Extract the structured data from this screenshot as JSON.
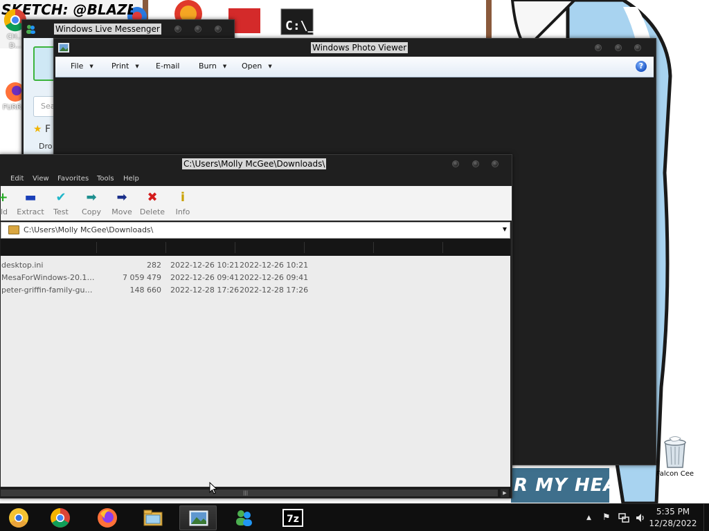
{
  "desktop": {
    "handle_text": "SKETCH: @BLAZENARF",
    "icons": [
      {
        "label": "CH..."
      },
      {
        "label": "D..."
      },
      {
        "label": "FURR..."
      }
    ],
    "recycle_bin_label": "Falcon Cee",
    "banner_text": "R MY HEAD..."
  },
  "messenger": {
    "title": "Windows Live Messenger",
    "search_placeholder": "Sea",
    "favorites_label": "F",
    "drop_label": "Dro"
  },
  "photo_viewer": {
    "title": "Windows Photo Viewer",
    "menu": [
      {
        "label": "File",
        "has_arrow": true
      },
      {
        "label": "Print",
        "has_arrow": true
      },
      {
        "label": "E-mail",
        "has_arrow": false
      },
      {
        "label": "Burn",
        "has_arrow": true
      },
      {
        "label": "Open",
        "has_arrow": true
      }
    ],
    "help_glyph": "?"
  },
  "zip": {
    "title": "C:\\Users\\Molly McGee\\Downloads\\",
    "menu": [
      "Edit",
      "View",
      "Favorites",
      "Tools",
      "Help"
    ],
    "toolbar": [
      {
        "label": "ld",
        "icon": "add-icon",
        "glyph": "+",
        "color": "#22aa22"
      },
      {
        "label": "Extract",
        "icon": "extract-icon",
        "glyph": "▬",
        "color": "#1a3fb8"
      },
      {
        "label": "Test",
        "icon": "test-icon",
        "glyph": "✔",
        "color": "#1fb6c9"
      },
      {
        "label": "Copy",
        "icon": "copy-icon",
        "glyph": "➡",
        "color": "#1d8f8f"
      },
      {
        "label": "Move",
        "icon": "move-icon",
        "glyph": "➡",
        "color": "#1a2f8a"
      },
      {
        "label": "Delete",
        "icon": "delete-icon",
        "glyph": "✖",
        "color": "#d41c1c"
      },
      {
        "label": "Info",
        "icon": "info-icon",
        "glyph": "i",
        "color": "#c9a100"
      }
    ],
    "path": "C:\\Users\\Molly McGee\\Downloads\\",
    "files": [
      {
        "name": "desktop.ini",
        "size": "282",
        "modified": "2022-12-26 10:21",
        "created": "2022-12-26 10:21"
      },
      {
        "name": "MesaForWindows-20.1....",
        "size": "7 059 479",
        "modified": "2022-12-26 09:41",
        "created": "2022-12-26 09:41"
      },
      {
        "name": "peter-griffin-family-guy....",
        "size": "148 660",
        "modified": "2022-12-28 17:26",
        "created": "2022-12-28 17:26"
      }
    ]
  },
  "taskbar": {
    "apps": [
      {
        "name": "chrome-canary-icon"
      },
      {
        "name": "chrome-icon"
      },
      {
        "name": "firefox-icon"
      },
      {
        "name": "file-explorer-icon"
      },
      {
        "name": "photo-viewer-icon",
        "active": true
      },
      {
        "name": "messenger-icon"
      },
      {
        "name": "7zip-icon",
        "label": "7z"
      }
    ],
    "clock_time": "5:35 PM",
    "clock_date": "12/28/2022"
  }
}
